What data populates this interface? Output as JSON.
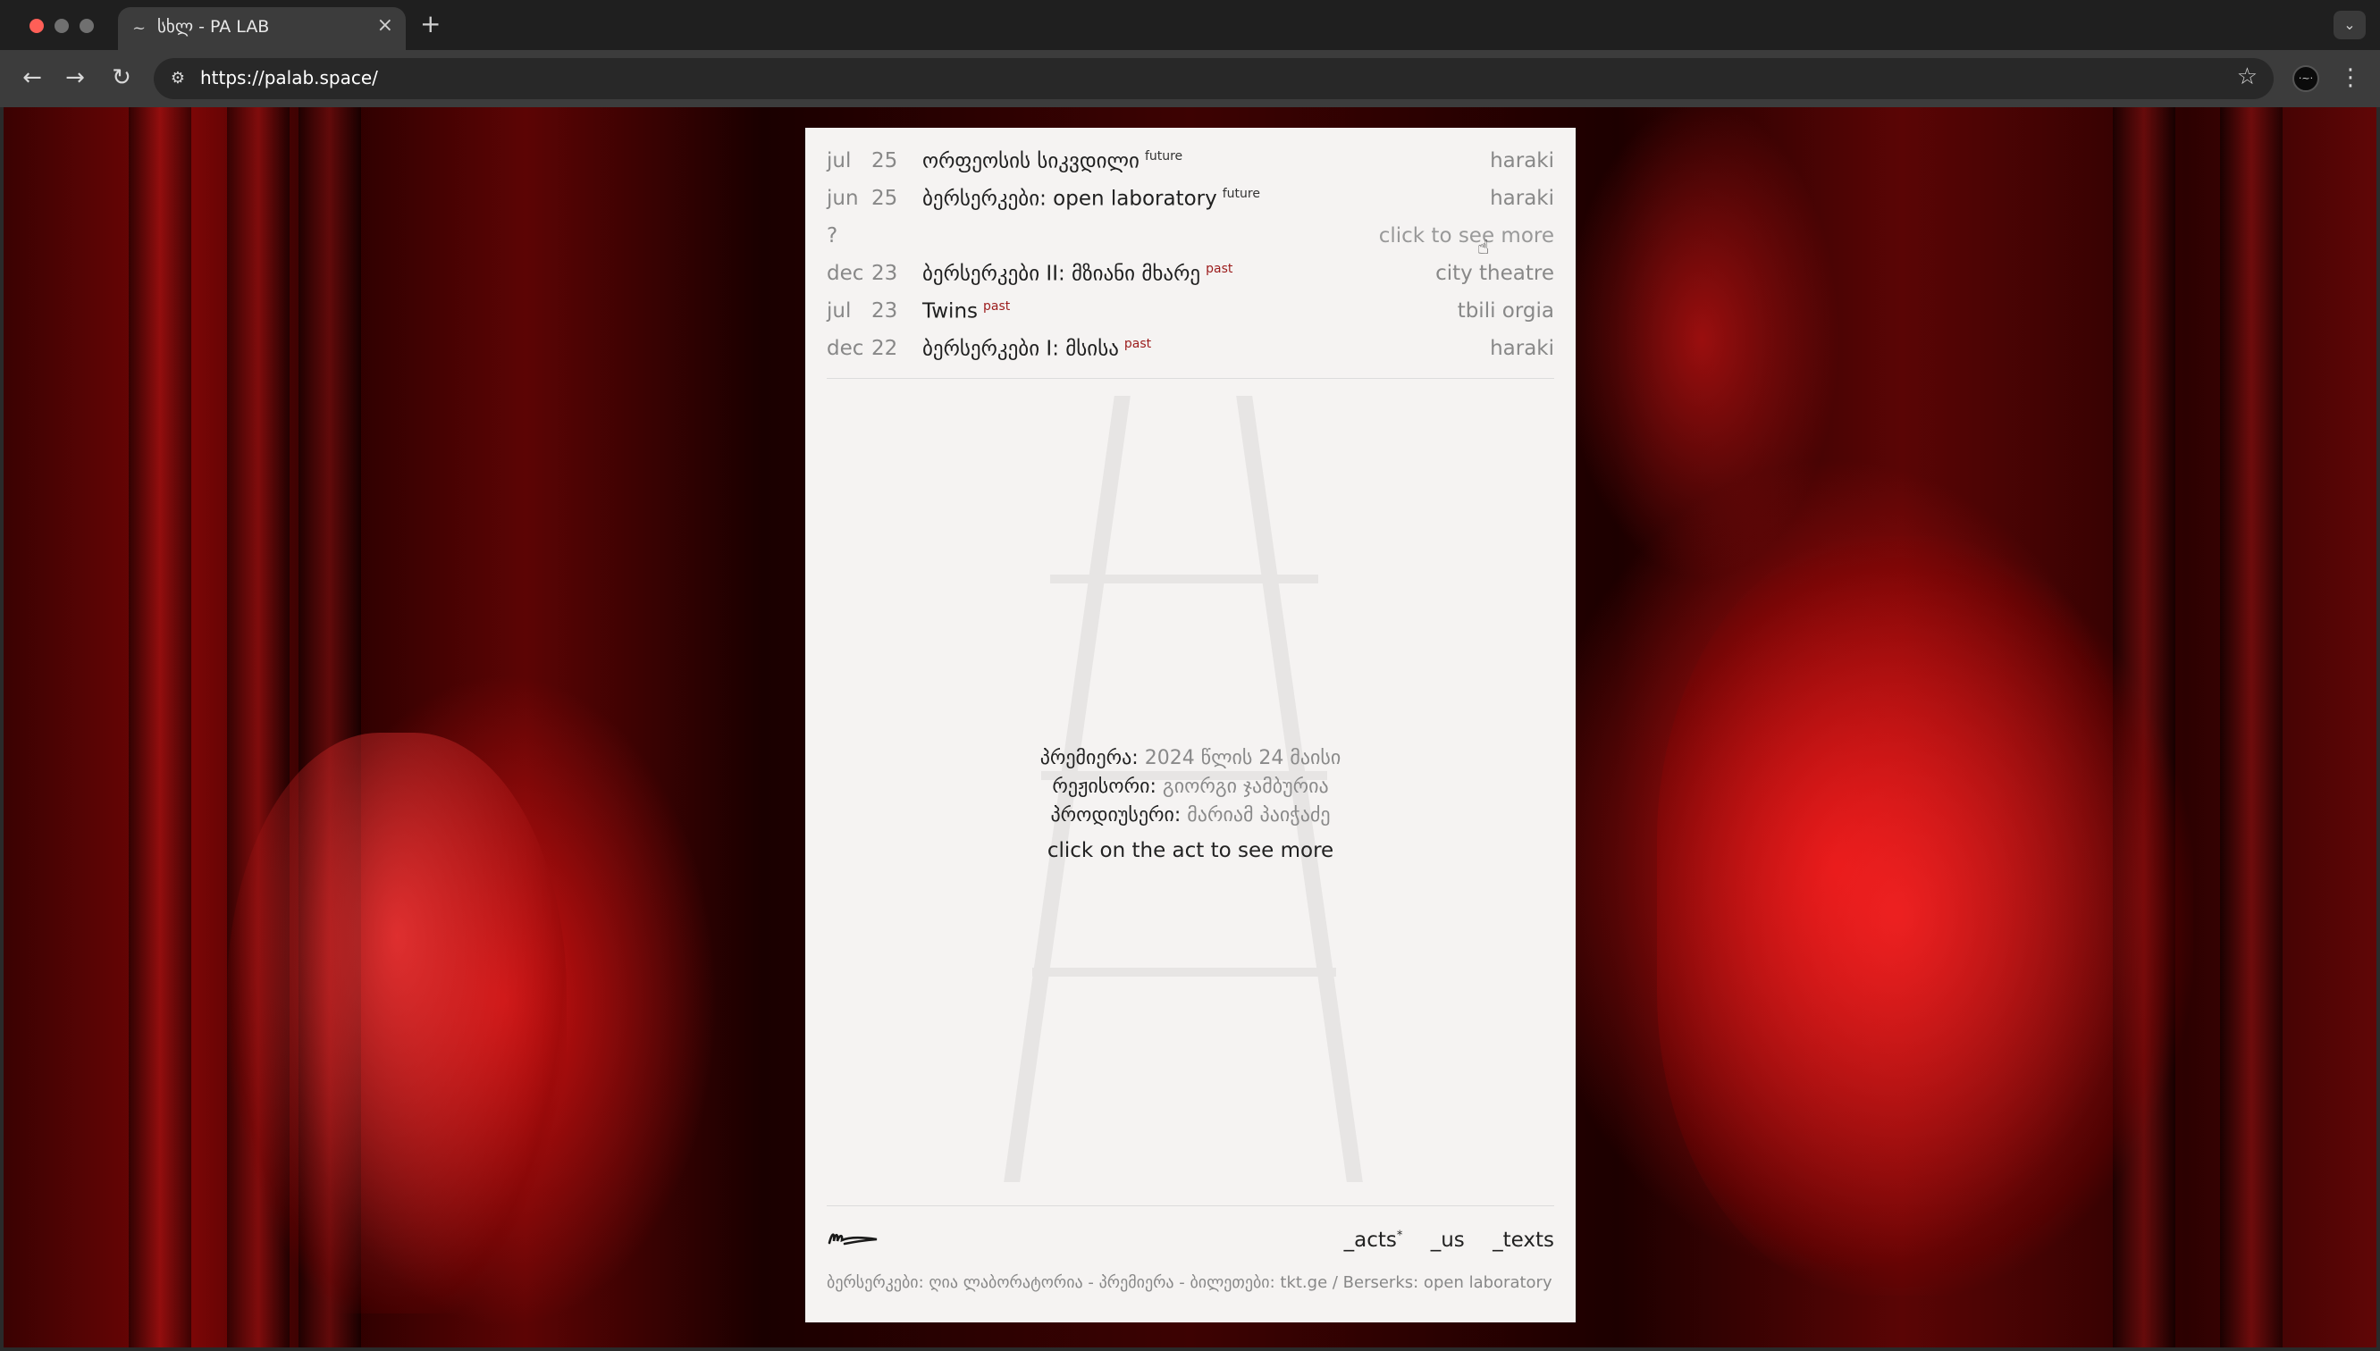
{
  "browser": {
    "tab_title": "სხლ - PA LAB",
    "url": "https://palab.space/"
  },
  "events": [
    {
      "month": "jul",
      "year": "25",
      "title": "ორფეოსის სიკვდილი",
      "status": "future",
      "venue": "haraki"
    },
    {
      "month": "jun",
      "year": "25",
      "title": "ბერსერკები: open laboratory",
      "status": "future",
      "venue": "haraki"
    },
    {
      "month": "dec",
      "year": "23",
      "title": "ბერსერკები II: მზიანი მხარე",
      "status": "past",
      "venue": "city theatre"
    },
    {
      "month": "jul",
      "year": "23",
      "title": "Twins",
      "status": "past",
      "venue": "tbili orgia"
    },
    {
      "month": "dec",
      "year": "22",
      "title": "ბერსერკები I: მსისა",
      "status": "past",
      "venue": "haraki"
    }
  ],
  "more_row": {
    "mark": "?",
    "label": "click to see more"
  },
  "credits": {
    "premiere_label": "პრემიერა:",
    "premiere_value": "2024 წლის 24 მაისი",
    "director_label": "რეჟისორი:",
    "director_value": "გიორგი ჯამბურია",
    "producer_label": "პროდიუსერი:",
    "producer_value": "მარიამ პაიჭაძე"
  },
  "cta": "click on the act to see more",
  "footer": {
    "nav": [
      {
        "label": "_acts",
        "marker": "*"
      },
      {
        "label": "_us",
        "marker": ""
      },
      {
        "label": "_texts",
        "marker": ""
      }
    ],
    "ticker": "ბერსერკები: ღია ლაბორატორია - პრემიერა - ბილეთები: tkt.ge / Berserks: open laboratory"
  },
  "icons": {
    "tab_favicon": "signature-icon",
    "logo": "signature-logo"
  }
}
